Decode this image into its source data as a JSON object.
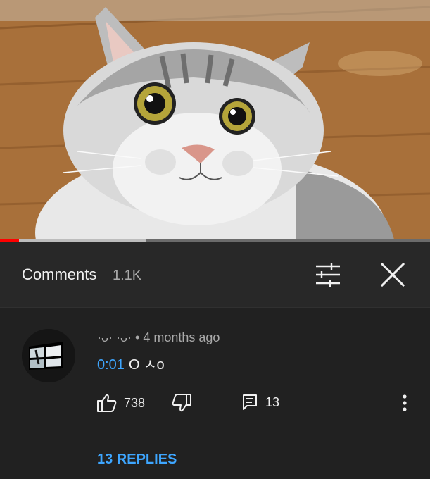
{
  "video": {
    "progress_fraction": 0.045,
    "buffer_fraction": 0.34,
    "colors": {
      "progress": "#ff0000",
      "buffer": "#bdbdbd",
      "track": "#6b6b6b"
    }
  },
  "comments_panel": {
    "title": "Comments",
    "count": "1.1K",
    "filter_icon": "sort-filter-icon",
    "close_icon": "close-icon"
  },
  "comment": {
    "author": "·ᴗ· ·ᴗ·",
    "separator": "•",
    "time_ago": "4 months ago",
    "timestamp_link": "0:01",
    "text": "O ㅅo",
    "likes": "738",
    "replies_count": "13",
    "replies_link": "13 REPLIES",
    "icons": {
      "like": "thumbs-up-icon",
      "dislike": "thumbs-down-icon",
      "reply": "reply-icon",
      "more": "more-vertical-icon"
    },
    "link_color": "#3ea6ff"
  }
}
